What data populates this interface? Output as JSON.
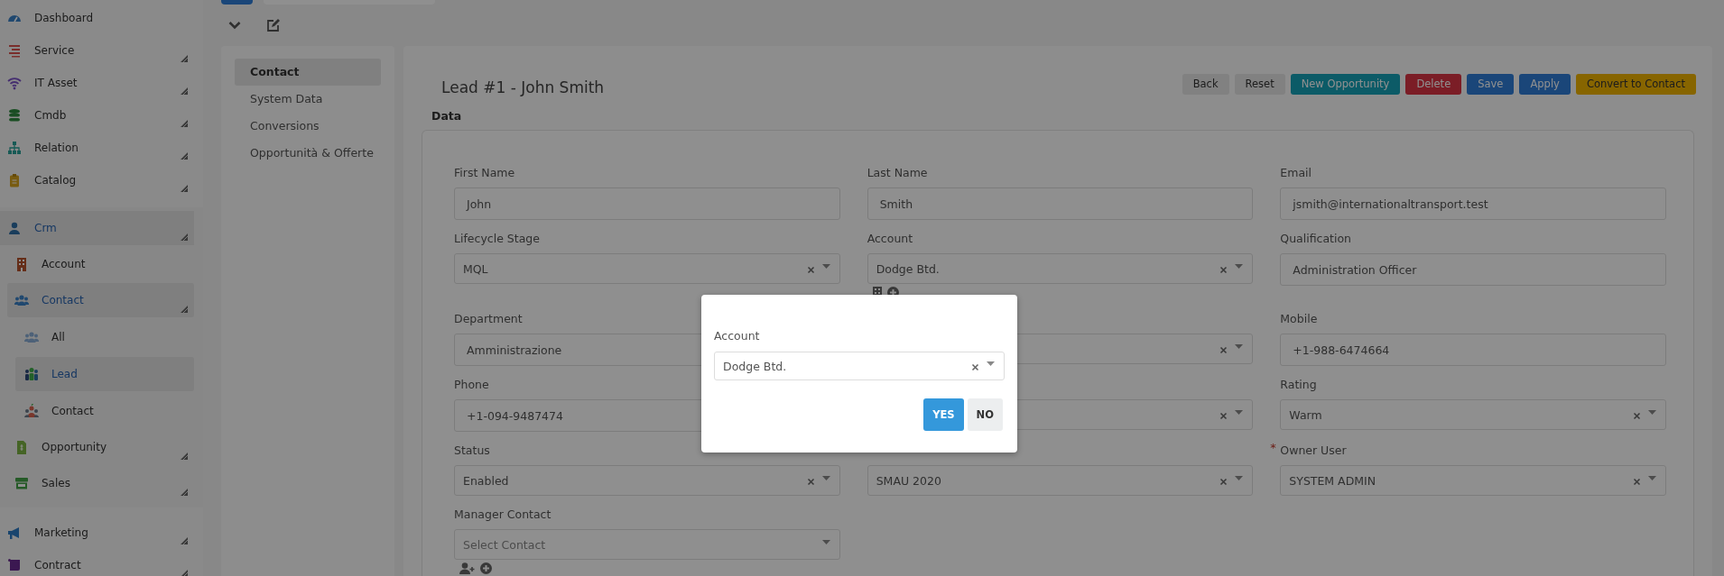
{
  "sidebar": {
    "items": [
      {
        "label": "Dashboard",
        "has_submenu": false,
        "selected": false
      },
      {
        "label": "Service",
        "has_submenu": true,
        "selected": false
      },
      {
        "label": "IT Asset",
        "has_submenu": true,
        "selected": false
      },
      {
        "label": "Cmdb",
        "has_submenu": true,
        "selected": false
      },
      {
        "label": "Relation",
        "has_submenu": true,
        "selected": false
      },
      {
        "label": "Catalog",
        "has_submenu": true,
        "selected": false
      },
      {
        "label": "Crm",
        "has_submenu": true,
        "selected": true,
        "children": [
          {
            "label": "Account",
            "has_submenu": false,
            "selected": false
          },
          {
            "label": "Contact",
            "has_submenu": true,
            "selected": true,
            "children": [
              {
                "label": "All",
                "has_submenu": false,
                "selected": false
              },
              {
                "label": "Lead",
                "has_submenu": false,
                "selected": true
              },
              {
                "label": "Contact",
                "has_submenu": false,
                "selected": false
              }
            ]
          },
          {
            "label": "Opportunity",
            "has_submenu": true,
            "selected": false
          },
          {
            "label": "Sales",
            "has_submenu": true,
            "selected": false
          }
        ]
      },
      {
        "label": "Marketing",
        "has_submenu": true,
        "selected": false
      },
      {
        "label": "Contract",
        "has_submenu": true,
        "selected": false
      }
    ]
  },
  "section_menu": [
    {
      "label": "Contact",
      "selected": true
    },
    {
      "label": "System Data",
      "selected": false
    },
    {
      "label": "Conversions",
      "selected": false
    },
    {
      "label": "Opportunità & Offerte",
      "selected": false
    }
  ],
  "record": {
    "title": "Lead #1 - John Smith",
    "section": "Data"
  },
  "buttons": [
    {
      "label": "Back",
      "kind": "secondary"
    },
    {
      "label": "Reset",
      "kind": "secondary"
    },
    {
      "label": "New Opportunity",
      "kind": "info"
    },
    {
      "label": "Delete",
      "kind": "danger"
    },
    {
      "label": "Save",
      "kind": "primary"
    },
    {
      "label": "Apply",
      "kind": "primary"
    },
    {
      "label": "Convert to Contact",
      "kind": "warning"
    }
  ],
  "form": {
    "fields": [
      {
        "label": "First Name",
        "kind": "text",
        "value": "John"
      },
      {
        "label": "Last Name",
        "kind": "text",
        "value": "Smith"
      },
      {
        "label": "Email",
        "kind": "text",
        "value": "jsmith@internationaltransport.test"
      },
      {
        "label": "Lifecycle Stage",
        "kind": "select",
        "value": "MQL"
      },
      {
        "label": "Account",
        "kind": "account",
        "value": "Dodge Btd."
      },
      {
        "label": "Qualification",
        "kind": "text",
        "value": "Administration Officer"
      },
      {
        "label": "Department",
        "kind": "text",
        "value": "Amministrazione"
      },
      {
        "kind": "select"
      },
      {
        "label": "Mobile",
        "kind": "text",
        "value": "+1-988-6474664"
      },
      {
        "label": "Phone",
        "kind": "text",
        "value": "+1-094-9487474"
      },
      {
        "kind": "select"
      },
      {
        "label": "Rating",
        "kind": "select",
        "value": "Warm"
      },
      {
        "label": "Status",
        "kind": "select",
        "value": "Enabled"
      },
      {
        "kind": "select",
        "value": "SMAU 2020"
      },
      {
        "label": "Owner User",
        "kind": "select",
        "value": "SYSTEM ADMIN",
        "required_mark": "*"
      },
      {
        "label": "Manager Contact",
        "kind": "contact",
        "placeholder": "Select Contact"
      }
    ]
  },
  "dialog": {
    "label": "Account",
    "value": "Dodge Btd.",
    "buttons": [
      {
        "label": "YES",
        "kind": "primary"
      },
      {
        "label": "NO",
        "kind": "secondary"
      }
    ]
  }
}
